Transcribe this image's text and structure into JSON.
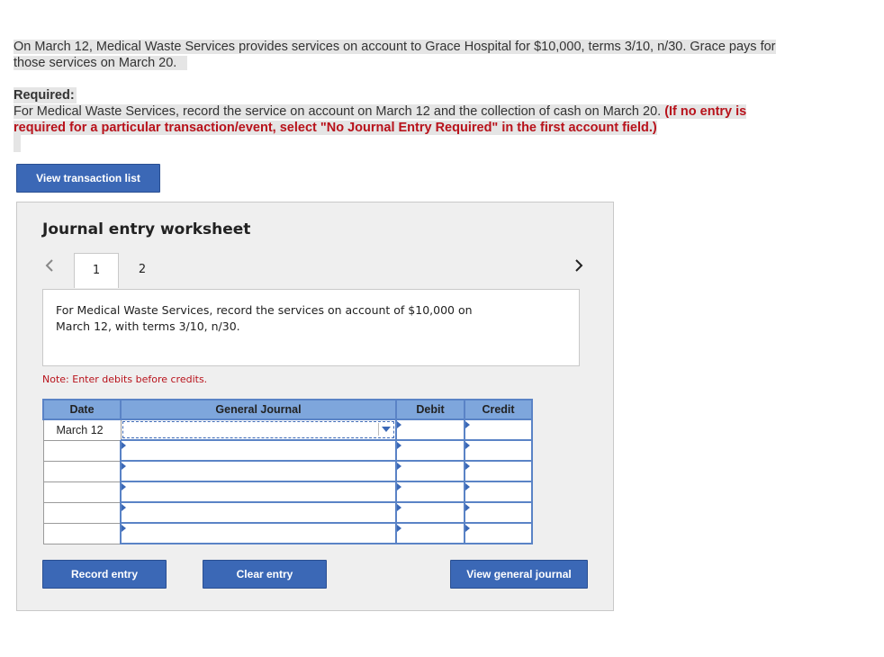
{
  "problem": {
    "line1": "On March 12, Medical Waste Services provides services on account to Grace Hospital for $10,000, terms 3/10, n/30. Grace pays for",
    "line2": "those services on March 20."
  },
  "required": {
    "label": "Required:",
    "text": "For Medical Waste Services, record the service on account on March 12 and the collection of cash on March 20. ",
    "instruction_line1": "(If no entry is",
    "instruction_line2": "required for a particular transaction/event, select \"No Journal Entry Required\" in the first account field.)"
  },
  "buttons": {
    "view_transaction_list": "View transaction list",
    "record_entry": "Record entry",
    "clear_entry": "Clear entry",
    "view_general_journal": "View general journal"
  },
  "worksheet": {
    "title": "Journal entry worksheet",
    "tabs": [
      "1",
      "2"
    ],
    "active_tab": "1",
    "instruction_line1": "For Medical Waste Services, record the services on account of $10,000 on",
    "instruction_line2": "March 12, with terms 3/10, n/30.",
    "note": "Note: Enter debits before credits."
  },
  "table": {
    "headers": {
      "date": "Date",
      "general_journal": "General Journal",
      "debit": "Debit",
      "credit": "Credit"
    },
    "rows": [
      {
        "date": "March 12",
        "account": "",
        "debit": "",
        "credit": ""
      },
      {
        "date": "",
        "account": "",
        "debit": "",
        "credit": ""
      },
      {
        "date": "",
        "account": "",
        "debit": "",
        "credit": ""
      },
      {
        "date": "",
        "account": "",
        "debit": "",
        "credit": ""
      },
      {
        "date": "",
        "account": "",
        "debit": "",
        "credit": ""
      },
      {
        "date": "",
        "account": "",
        "debit": "",
        "credit": ""
      }
    ]
  },
  "colors": {
    "accent": "#3b68b6",
    "header_bg": "#7ea6dc",
    "warning": "#b8121b"
  }
}
